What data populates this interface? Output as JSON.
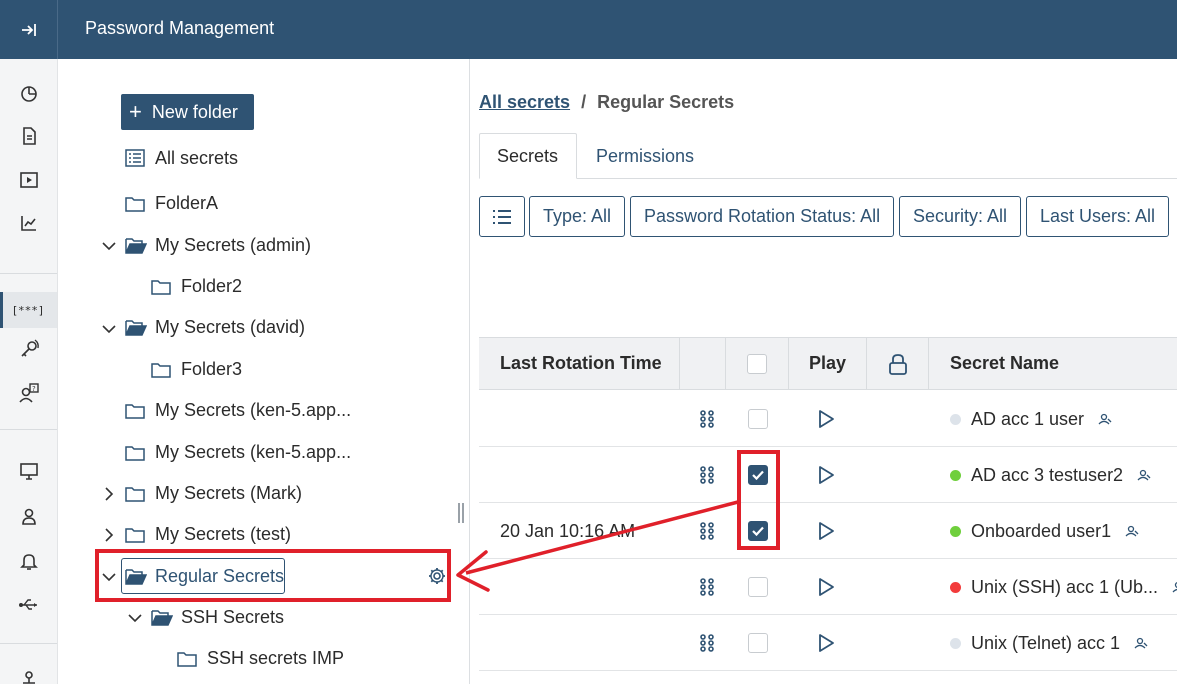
{
  "header": {
    "title": "Password Management",
    "collapse_icon": "expand-sidebar-icon"
  },
  "rail": {
    "icons": [
      "pie-chart-icon",
      "document-icon",
      "play-icon",
      "trend-chart-icon",
      "secrets-icon",
      "key-icon",
      "user-question-icon",
      "monitor-icon",
      "user-icon",
      "bell-icon",
      "usb-icon"
    ],
    "secrets_label": "[***]"
  },
  "tree": {
    "new_folder_label": "New folder",
    "all_secrets": "All secrets",
    "nodes": [
      {
        "label": "FolderA"
      },
      {
        "label": "My Secrets (admin)"
      },
      {
        "label": "Folder2"
      },
      {
        "label": "My Secrets (david)"
      },
      {
        "label": "Folder3"
      },
      {
        "label": "My Secrets (ken-5.app..."
      },
      {
        "label": "My Secrets (ken-5.app..."
      },
      {
        "label": "My Secrets (Mark)"
      },
      {
        "label": "My Secrets (test)"
      },
      {
        "label": "Regular Secrets"
      },
      {
        "label": "SSH Secrets"
      },
      {
        "label": "SSH secrets IMP"
      }
    ]
  },
  "breadcrumb": {
    "link": "All secrets",
    "separator": "/",
    "current": "Regular Secrets"
  },
  "tabs": [
    {
      "label": "Secrets"
    },
    {
      "label": "Permissions"
    }
  ],
  "filters": [
    {
      "label": "Type: All"
    },
    {
      "label": "Password Rotation Status: All"
    },
    {
      "label": "Security: All"
    },
    {
      "label": "Last Users: All"
    }
  ],
  "table": {
    "columns": {
      "last_rotation": "Last Rotation Time",
      "play": "Play",
      "secret_name": "Secret Name"
    },
    "rows": [
      {
        "last_rotation": "",
        "checked": false,
        "secret_name": "AD acc 1 user",
        "status_color": "#dde3ea"
      },
      {
        "last_rotation": "",
        "checked": true,
        "secret_name": "AD acc 3 testuser2",
        "status_color": "#6fcf3c"
      },
      {
        "last_rotation": "20 Jan 10:16 AM",
        "checked": true,
        "secret_name": "Onboarded user1",
        "status_color": "#6fcf3c"
      },
      {
        "last_rotation": "",
        "checked": false,
        "secret_name": "Unix (SSH) acc 1 (Ub...",
        "status_color": "#f23b3b"
      },
      {
        "last_rotation": "",
        "checked": false,
        "secret_name": "Unix (Telnet) acc 1",
        "status_color": "#dde3ea"
      }
    ]
  },
  "colors": {
    "primary": "#2f5373",
    "annotation": "#e0202a"
  }
}
